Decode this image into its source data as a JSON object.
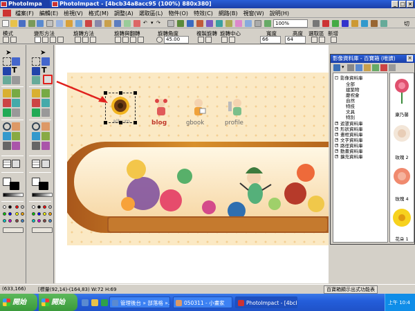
{
  "titlebar": {
    "tabs": [
      "PhotoImpa",
      "PhotoImpact - [4bcb34a8acc95 (100%) 880x380]"
    ]
  },
  "menu": {
    "items": [
      "檔案(F)",
      "編輯(E)",
      "檢視(V)",
      "格式(M)",
      "調整(A)",
      "選取區(L)",
      "物件(O)",
      "特效(C)",
      "網路(B)",
      "視窗(W)",
      "說明(H)"
    ]
  },
  "toolbar": {
    "zoom_value": "100%",
    "right_label": "切"
  },
  "attrbar": {
    "labels": [
      "模式",
      "變形方法",
      "旋轉方法",
      "旋轉與翻轉",
      "旋轉角度",
      "複製旋轉",
      "旋轉中心",
      "寬度",
      "高度",
      "選取區",
      "新增"
    ],
    "rotation_angle": "45.00",
    "width_value": "66",
    "height_value": "64"
  },
  "canvas": {
    "nav": [
      "album",
      "blog",
      "gbook",
      "profile"
    ]
  },
  "library": {
    "title": "影像資料庫 - 百寶箱 (唯讀)",
    "tree_root": "影像資料庫",
    "tree_children": [
      "全部",
      "建築物",
      "慶祝會",
      "自然",
      "特技",
      "文具",
      "特別"
    ],
    "tree_groups": [
      "遮罩資料庫",
      "形狀資料庫",
      "畫框資料庫",
      "文字資料庫",
      "路徑資料庫",
      "動畫資料庫",
      "擴充資料庫"
    ],
    "thumbs": [
      "康乃馨",
      "玫瑰 2",
      "玫瑰 4",
      "花朵 1"
    ]
  },
  "statusbar": {
    "coords": "(633,166)",
    "info": "[標量(92,14)-(164,83) W:72 H:69",
    "right": "百寶箱顯示出式功能表"
  },
  "taskbar": {
    "start_left": "開始",
    "start_right": "開始",
    "tasks": [
      "管理後台 » 部落格 »...",
      "050311 - 小畫家",
      "PhotoImpact - [4bcb3..."
    ],
    "tray_time": "上午 10:4"
  },
  "colors": {
    "title_blue": "#1b3fa8",
    "taskbar_blue": "#245edb",
    "start_green": "#3a9a3a",
    "blog_red": "#c0392b",
    "arrow_red": "#e0211d",
    "banner_brown": "#c87a1c"
  }
}
